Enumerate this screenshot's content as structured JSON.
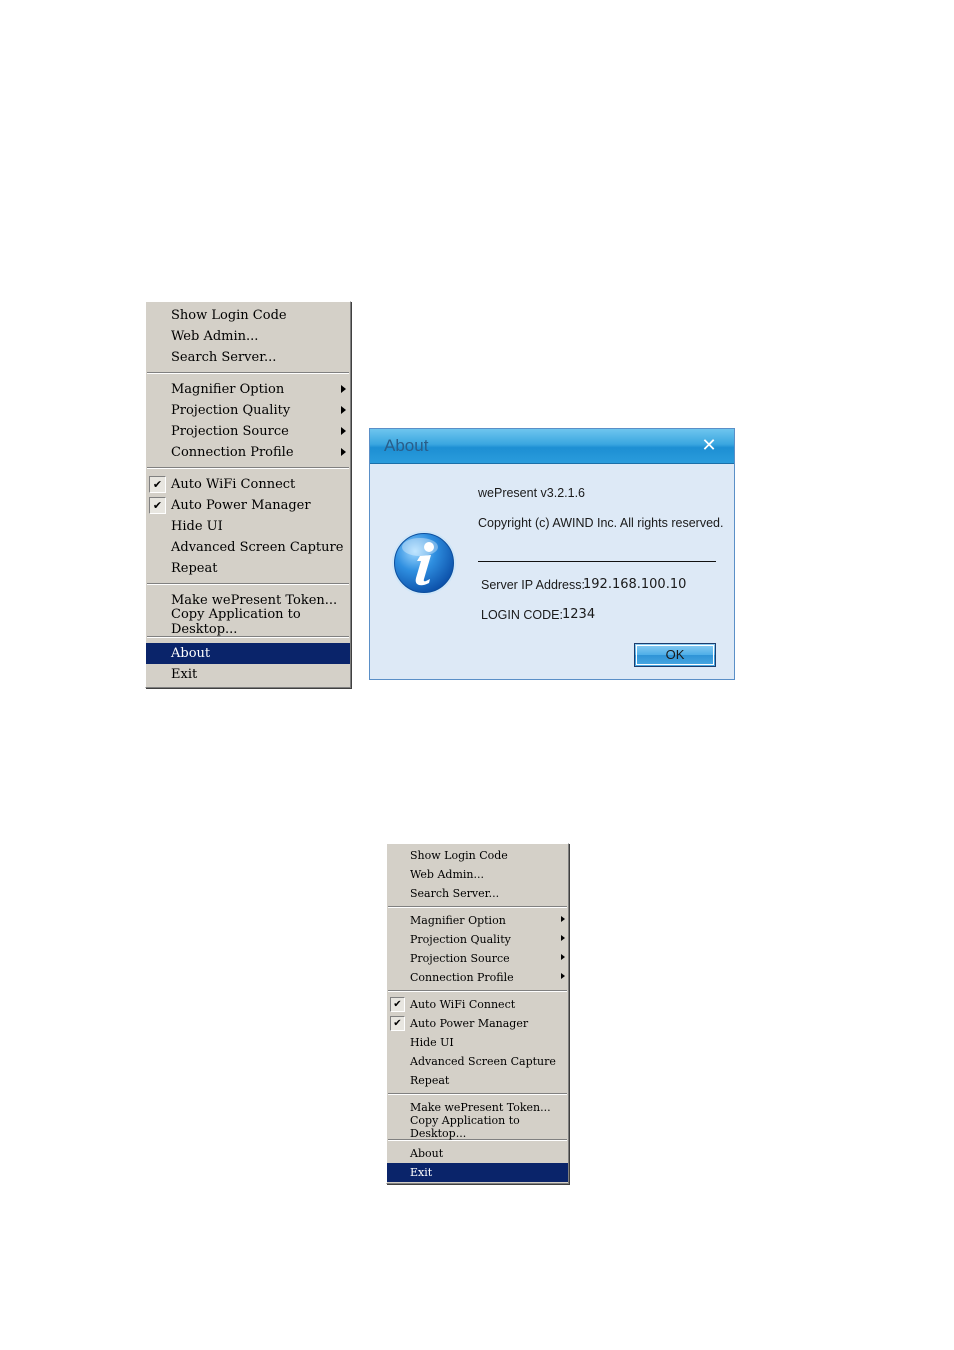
{
  "menu_primary": {
    "groups": [
      [
        {
          "label": "Show Login Code",
          "checked": false,
          "submenu": false
        },
        {
          "label": "Web Admin...",
          "checked": false,
          "submenu": false
        },
        {
          "label": "Search Server...",
          "checked": false,
          "submenu": false
        }
      ],
      [
        {
          "label": "Magnifier Option",
          "checked": false,
          "submenu": true
        },
        {
          "label": "Projection Quality",
          "checked": false,
          "submenu": true
        },
        {
          "label": "Projection Source",
          "checked": false,
          "submenu": true
        },
        {
          "label": "Connection Profile",
          "checked": false,
          "submenu": true
        }
      ],
      [
        {
          "label": "Auto WiFi Connect",
          "checked": true,
          "submenu": false
        },
        {
          "label": "Auto Power Manager",
          "checked": true,
          "submenu": false
        },
        {
          "label": "Hide UI",
          "checked": false,
          "submenu": false
        },
        {
          "label": "Advanced Screen Capture",
          "checked": false,
          "submenu": false
        },
        {
          "label": "Repeat",
          "checked": false,
          "submenu": false
        }
      ],
      [
        {
          "label": "Make wePresent Token...",
          "checked": false,
          "submenu": false
        },
        {
          "label": "Copy Application to Desktop...",
          "checked": false,
          "submenu": false
        }
      ],
      [
        {
          "label": "About",
          "checked": false,
          "submenu": false,
          "selected": true
        },
        {
          "label": "Exit",
          "checked": false,
          "submenu": false
        }
      ]
    ]
  },
  "menu_secondary": {
    "groups": [
      [
        {
          "label": "Show Login Code",
          "checked": false,
          "submenu": false
        },
        {
          "label": "Web Admin...",
          "checked": false,
          "submenu": false
        },
        {
          "label": "Search Server...",
          "checked": false,
          "submenu": false
        }
      ],
      [
        {
          "label": "Magnifier Option",
          "checked": false,
          "submenu": true
        },
        {
          "label": "Projection Quality",
          "checked": false,
          "submenu": true
        },
        {
          "label": "Projection Source",
          "checked": false,
          "submenu": true
        },
        {
          "label": "Connection Profile",
          "checked": false,
          "submenu": true
        }
      ],
      [
        {
          "label": "Auto WiFi Connect",
          "checked": true,
          "submenu": false
        },
        {
          "label": "Auto Power Manager",
          "checked": true,
          "submenu": false
        },
        {
          "label": "Hide UI",
          "checked": false,
          "submenu": false
        },
        {
          "label": "Advanced Screen Capture",
          "checked": false,
          "submenu": false
        },
        {
          "label": "Repeat",
          "checked": false,
          "submenu": false
        }
      ],
      [
        {
          "label": "Make wePresent Token...",
          "checked": false,
          "submenu": false
        },
        {
          "label": "Copy Application to Desktop...",
          "checked": false,
          "submenu": false
        }
      ],
      [
        {
          "label": "About",
          "checked": false,
          "submenu": false
        },
        {
          "label": "Exit",
          "checked": false,
          "submenu": false,
          "selected": true
        }
      ]
    ]
  },
  "about_dialog": {
    "title": "About",
    "close_glyph": "✕",
    "icon": "info-icon",
    "version": "wePresent v3.2.1.6",
    "copyright": "Copyright (c) AWIND Inc. All rights reserved.",
    "server_ip_label": "Server IP Address:",
    "server_ip_value": "192.168.100.10",
    "login_code_label": "LOGIN CODE:",
    "login_code_value": "1234",
    "ok_label": "OK"
  },
  "colors": {
    "menu_bg": "#d4d0c8",
    "menu_selected_bg": "#0a246a",
    "dialog_bg": "#dde9f6",
    "titlebar": "#3aa6e0"
  }
}
